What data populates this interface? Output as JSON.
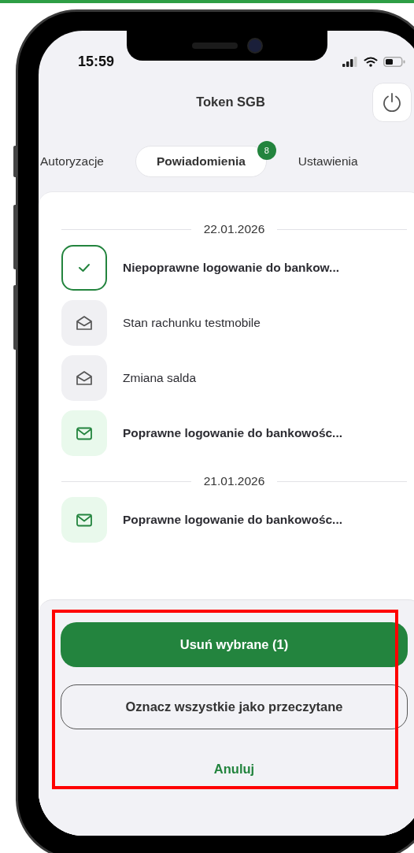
{
  "status_bar": {
    "time": "15:59"
  },
  "header": {
    "title": "Token SGB"
  },
  "tabs": [
    {
      "label": "Autoryzacje",
      "selected": false
    },
    {
      "label": "Powiadomienia",
      "selected": true,
      "badge": "8"
    },
    {
      "label": "Ustawienia",
      "selected": false
    }
  ],
  "groups": [
    {
      "date": "22.01.2026",
      "items": [
        {
          "title": "Niepoprawne logowanie do bankow...",
          "unread": true,
          "selected": true
        },
        {
          "title": "Stan rachunku testmobile",
          "unread": false,
          "selected": false
        },
        {
          "title": "Zmiana salda",
          "unread": false,
          "selected": false
        },
        {
          "title": "Poprawne logowanie do bankowośc...",
          "unread": true,
          "selected": false
        }
      ]
    },
    {
      "date": "21.01.2026",
      "items": [
        {
          "title": "Poprawne logowanie do bankowośc...",
          "unread": true,
          "selected": false
        }
      ]
    }
  ],
  "action_sheet": {
    "highlighted": true,
    "buttons": [
      {
        "label": "Usuń wybrane (1)",
        "kind": "primary"
      },
      {
        "label": "Oznacz wszystkie jako przeczytane",
        "kind": "outline"
      },
      {
        "label": "Anuluj",
        "kind": "text"
      }
    ]
  }
}
